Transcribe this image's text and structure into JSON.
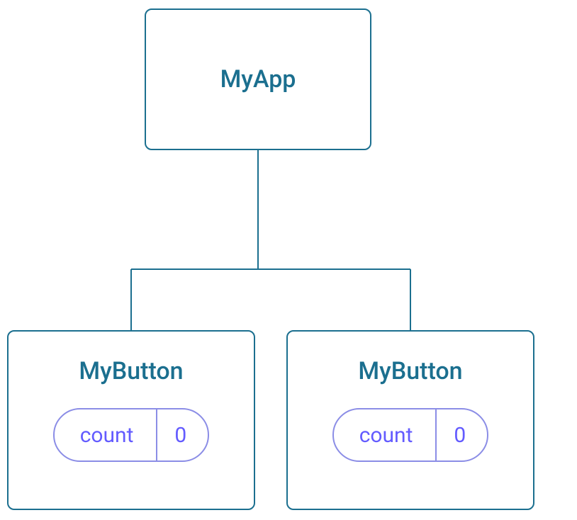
{
  "root": {
    "title": "MyApp"
  },
  "children": [
    {
      "title": "MyButton",
      "state_label": "count",
      "state_value": "0"
    },
    {
      "title": "MyButton",
      "state_label": "count",
      "state_value": "0"
    }
  ],
  "colors": {
    "node_border": "#1b6f8f",
    "node_text": "#1b6f8f",
    "pill_border": "#8b8de6",
    "pill_text": "#635bff"
  }
}
